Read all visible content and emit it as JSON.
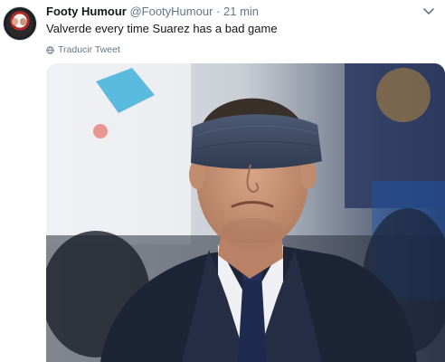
{
  "tweet": {
    "author_name": "Footy Humour",
    "author_handle": "@FootyHumour",
    "separator": "·",
    "time": "21 min",
    "text": "Valverde every time Suarez has a bad game",
    "translate_label": "Traducir Tweet"
  },
  "icons": {
    "menu": "chevron-down-icon",
    "translate": "globe-icon"
  },
  "colors": {
    "text_primary": "#14171a",
    "text_secondary": "#657786",
    "blindfold": "#3f4b63",
    "suit": "#1c2436",
    "tie": "#1e2a4e"
  }
}
